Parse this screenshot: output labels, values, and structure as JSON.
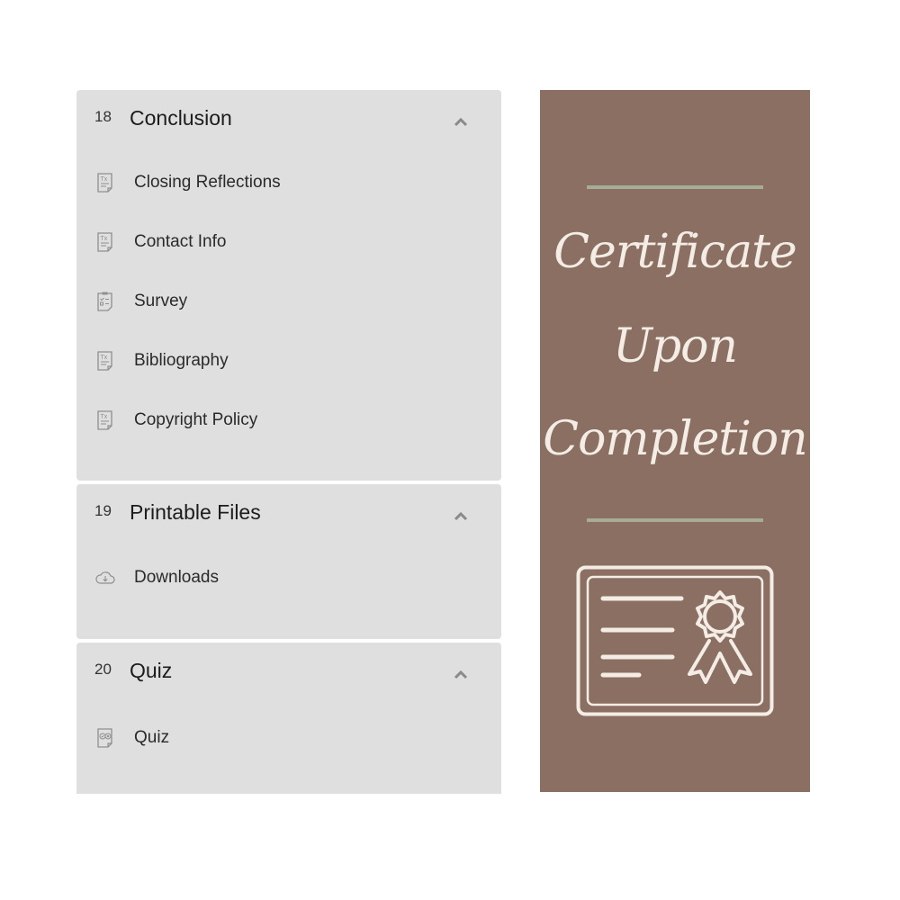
{
  "modules": [
    {
      "number": "18",
      "title": "Conclusion",
      "lessons": [
        {
          "label": "Closing Reflections",
          "icon": "text-document-icon"
        },
        {
          "label": "Contact Info",
          "icon": "text-document-icon"
        },
        {
          "label": "Survey",
          "icon": "survey-clipboard-icon"
        },
        {
          "label": "Bibliography",
          "icon": "text-document-icon"
        },
        {
          "label": "Copyright Policy",
          "icon": "text-document-icon"
        }
      ]
    },
    {
      "number": "19",
      "title": "Printable Files",
      "lessons": [
        {
          "label": "Downloads",
          "icon": "cloud-download-icon"
        }
      ]
    },
    {
      "number": "20",
      "title": "Quiz",
      "lessons": [
        {
          "label": "Quiz",
          "icon": "quiz-icon"
        }
      ]
    }
  ],
  "certificate": {
    "line1": "Certificate",
    "line2": "Upon",
    "line3": "Completion",
    "icon": "certificate-icon",
    "colors": {
      "background": "#8c6f63",
      "accent_rule": "#a7ac97",
      "text": "#f3ede6"
    }
  }
}
